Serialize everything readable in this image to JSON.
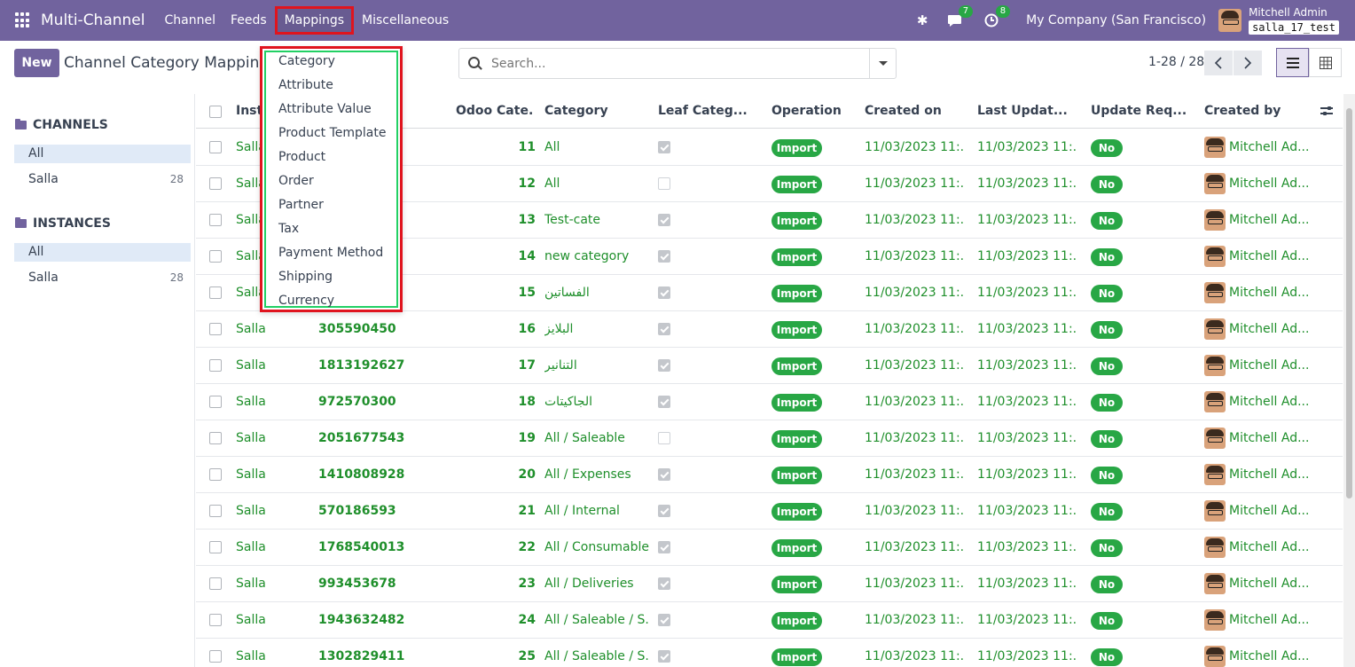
{
  "navbar": {
    "app_title": "Multi-Channel",
    "menus": [
      "Channel",
      "Feeds",
      "Mappings",
      "Miscellaneous"
    ],
    "activity_count": "7",
    "chat_count": "8",
    "company": "My Company (San Francisco)",
    "user_name": "Mitchell Admin",
    "database": "salla_17_test"
  },
  "control_panel": {
    "new_label": "New",
    "title": "Channel Category Mappings",
    "search_placeholder": "Search...",
    "pager": "1-28 / 28"
  },
  "sidebar": {
    "channels_header": "CHANNELS",
    "channels": [
      {
        "label": "All",
        "count": ""
      },
      {
        "label": "Salla",
        "count": "28"
      }
    ],
    "instances_header": "INSTANCES",
    "instances": [
      {
        "label": "All",
        "count": ""
      },
      {
        "label": "Salla",
        "count": "28"
      }
    ]
  },
  "table": {
    "columns": [
      "Insta",
      "Odoo Cate...",
      "Category",
      "Leaf Categ...",
      "Operation",
      "Created on",
      "Last Updat...",
      "Update Req...",
      "Created by"
    ],
    "rows": [
      {
        "instance": "Salla",
        "store_id": "",
        "odoo_id": "11",
        "category": "All",
        "leaf": true,
        "operation": "Import",
        "created_on": "11/03/2023 11:...",
        "last_updated": "11/03/2023 11:...",
        "update_required": "No",
        "created_by": "Mitchell Ad..."
      },
      {
        "instance": "Salla",
        "store_id": "",
        "odoo_id": "12",
        "category": "All",
        "leaf": false,
        "operation": "Import",
        "created_on": "11/03/2023 11:...",
        "last_updated": "11/03/2023 11:...",
        "update_required": "No",
        "created_by": "Mitchell Ad..."
      },
      {
        "instance": "Salla",
        "store_id": "",
        "odoo_id": "13",
        "category": "Test-cate",
        "leaf": true,
        "operation": "Import",
        "created_on": "11/03/2023 11:...",
        "last_updated": "11/03/2023 11:...",
        "update_required": "No",
        "created_by": "Mitchell Ad..."
      },
      {
        "instance": "Salla",
        "store_id": "",
        "odoo_id": "14",
        "category": "new category",
        "leaf": true,
        "operation": "Import",
        "created_on": "11/03/2023 11:...",
        "last_updated": "11/03/2023 11:...",
        "update_required": "No",
        "created_by": "Mitchell Ad..."
      },
      {
        "instance": "Salla",
        "store_id": "",
        "odoo_id": "15",
        "category": "الفساتين",
        "leaf": true,
        "operation": "Import",
        "created_on": "11/03/2023 11:...",
        "last_updated": "11/03/2023 11:...",
        "update_required": "No",
        "created_by": "Mitchell Ad..."
      },
      {
        "instance": "Salla",
        "store_id": "305590450",
        "odoo_id": "16",
        "category": "البلايز",
        "leaf": true,
        "operation": "Import",
        "created_on": "11/03/2023 11:...",
        "last_updated": "11/03/2023 11:...",
        "update_required": "No",
        "created_by": "Mitchell Ad..."
      },
      {
        "instance": "Salla",
        "store_id": "1813192627",
        "odoo_id": "17",
        "category": "التنانير",
        "leaf": true,
        "operation": "Import",
        "created_on": "11/03/2023 11:...",
        "last_updated": "11/03/2023 11:...",
        "update_required": "No",
        "created_by": "Mitchell Ad..."
      },
      {
        "instance": "Salla",
        "store_id": "972570300",
        "odoo_id": "18",
        "category": "الجاكيتات",
        "leaf": true,
        "operation": "Import",
        "created_on": "11/03/2023 11:...",
        "last_updated": "11/03/2023 11:...",
        "update_required": "No",
        "created_by": "Mitchell Ad..."
      },
      {
        "instance": "Salla",
        "store_id": "2051677543",
        "odoo_id": "19",
        "category": "All / Saleable",
        "leaf": false,
        "operation": "Import",
        "created_on": "11/03/2023 11:...",
        "last_updated": "11/03/2023 11:...",
        "update_required": "No",
        "created_by": "Mitchell Ad..."
      },
      {
        "instance": "Salla",
        "store_id": "1410808928",
        "odoo_id": "20",
        "category": "All / Expenses",
        "leaf": true,
        "operation": "Import",
        "created_on": "11/03/2023 11:...",
        "last_updated": "11/03/2023 11:...",
        "update_required": "No",
        "created_by": "Mitchell Ad..."
      },
      {
        "instance": "Salla",
        "store_id": "570186593",
        "odoo_id": "21",
        "category": "All / Internal",
        "leaf": true,
        "operation": "Import",
        "created_on": "11/03/2023 11:...",
        "last_updated": "11/03/2023 11:...",
        "update_required": "No",
        "created_by": "Mitchell Ad..."
      },
      {
        "instance": "Salla",
        "store_id": "1768540013",
        "odoo_id": "22",
        "category": "All / Consumable",
        "leaf": true,
        "operation": "Import",
        "created_on": "11/03/2023 11:...",
        "last_updated": "11/03/2023 11:...",
        "update_required": "No",
        "created_by": "Mitchell Ad..."
      },
      {
        "instance": "Salla",
        "store_id": "993453678",
        "odoo_id": "23",
        "category": "All / Deliveries",
        "leaf": true,
        "operation": "Import",
        "created_on": "11/03/2023 11:...",
        "last_updated": "11/03/2023 11:...",
        "update_required": "No",
        "created_by": "Mitchell Ad..."
      },
      {
        "instance": "Salla",
        "store_id": "1943632482",
        "odoo_id": "24",
        "category": "All / Saleable / S...",
        "leaf": true,
        "operation": "Import",
        "created_on": "11/03/2023 11:...",
        "last_updated": "11/03/2023 11:...",
        "update_required": "No",
        "created_by": "Mitchell Ad..."
      },
      {
        "instance": "Salla",
        "store_id": "1302829411",
        "odoo_id": "25",
        "category": "All / Saleable / S...",
        "leaf": true,
        "operation": "Import",
        "created_on": "11/03/2023 11:...",
        "last_updated": "11/03/2023 11:...",
        "update_required": "No",
        "created_by": "Mitchell Ad..."
      }
    ]
  },
  "mappings_menu": {
    "items": [
      "Category",
      "Attribute",
      "Attribute Value",
      "Product Template",
      "Product",
      "Order",
      "Partner",
      "Tax",
      "Payment Method",
      "Shipping",
      "Currency"
    ]
  },
  "colors": {
    "navbar": "#71639e",
    "accent_green": "#28a745",
    "highlight_red": "#e0141e",
    "highlight_green": "#22d064"
  }
}
